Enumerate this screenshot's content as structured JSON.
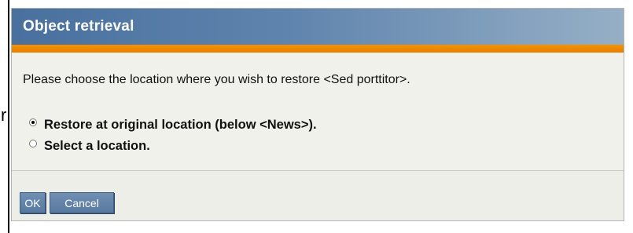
{
  "background": {
    "fragment_text": "r"
  },
  "dialog": {
    "title": "Object retrieval",
    "message": "Please choose the location where you wish to restore <Sed porttitor>.",
    "options": [
      {
        "label": "Restore at original location (below <News>).",
        "selected": true
      },
      {
        "label": "Select a location.",
        "selected": false
      }
    ],
    "buttons": {
      "ok_label": "OK",
      "cancel_label": "Cancel"
    },
    "colors": {
      "title_bar": "#5f84ad",
      "accent_bar": "#f29300",
      "button": "#6f8fb3",
      "body": "#f1f1ec"
    }
  }
}
